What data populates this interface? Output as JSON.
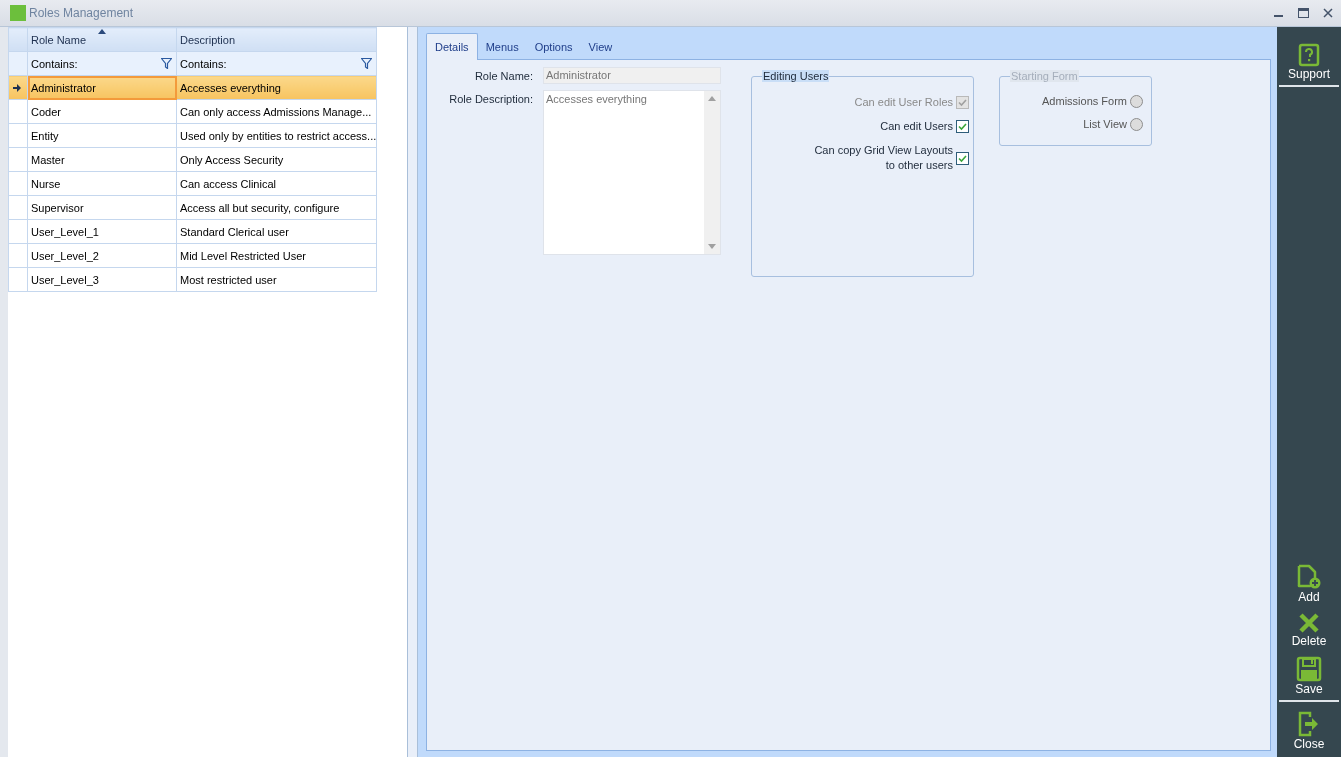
{
  "window": {
    "title": "Roles Management"
  },
  "grid": {
    "columns": [
      {
        "label": "Role Name",
        "sorted": true
      },
      {
        "label": "Description",
        "sorted": false
      }
    ],
    "filters": [
      "Contains:",
      "Contains:"
    ],
    "rows": [
      {
        "cells": [
          "Administrator",
          "Accesses everything"
        ],
        "selected": true
      },
      {
        "cells": [
          "Coder",
          "Can only access Admissions Manage..."
        ],
        "selected": false
      },
      {
        "cells": [
          "Entity",
          "Used only by entities to restrict access..."
        ],
        "selected": false
      },
      {
        "cells": [
          "Master",
          "Only Access Security"
        ],
        "selected": false
      },
      {
        "cells": [
          "Nurse",
          "Can access Clinical"
        ],
        "selected": false
      },
      {
        "cells": [
          "Supervisor",
          "Access all but security, configure"
        ],
        "selected": false
      },
      {
        "cells": [
          "User_Level_1",
          "Standard Clerical user"
        ],
        "selected": false
      },
      {
        "cells": [
          "User_Level_2",
          "Mid Level Restricted User"
        ],
        "selected": false
      },
      {
        "cells": [
          "User_Level_3",
          "Most restricted user"
        ],
        "selected": false
      }
    ]
  },
  "tabs": [
    {
      "label": "Details",
      "selected": true
    },
    {
      "label": "Menus",
      "selected": false
    },
    {
      "label": "Options",
      "selected": false
    },
    {
      "label": "View",
      "selected": false
    }
  ],
  "details": {
    "role_name": {
      "label": "Role Name:",
      "value": "Administrator"
    },
    "role_description": {
      "label": "Role Description:",
      "value": "Accesses everything"
    },
    "editing_users": {
      "title": "Editing Users",
      "options": [
        {
          "label": "Can edit User Roles",
          "checked": true,
          "disabled": true
        },
        {
          "label": "Can edit Users",
          "checked": true,
          "disabled": false
        },
        {
          "label": "Can copy Grid View Layouts\nto other users",
          "checked": true,
          "disabled": false
        }
      ]
    },
    "starting_form": {
      "title": "Starting Form",
      "disabled": true,
      "options": [
        {
          "label": "Admissions Form",
          "selected": false
        },
        {
          "label": "List View",
          "selected": false
        }
      ]
    }
  },
  "sidebar": {
    "top": [
      {
        "label": "Support",
        "kind": "support"
      }
    ],
    "bottom": [
      {
        "label": "Add",
        "kind": "add"
      },
      {
        "label": "Delete",
        "kind": "delete"
      },
      {
        "label": "Save",
        "kind": "save"
      },
      {
        "label": "Close",
        "kind": "close"
      }
    ]
  }
}
